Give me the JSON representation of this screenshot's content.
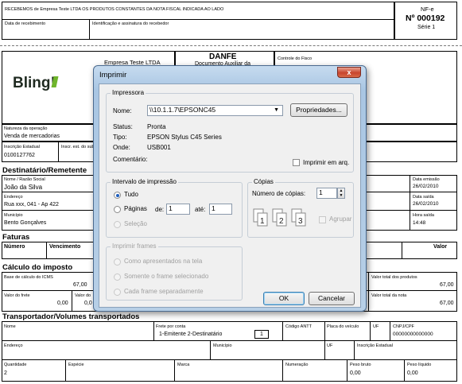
{
  "doc": {
    "recebemos": "RECEBEMOS de Empresa Teste LTDA OS PRODUTOS CONSTANTES DA NOTA FISCAL INDICADA AO LADO",
    "data_recebimento": "Data de recebimento",
    "identificacao": "Identificação e assinatura do recebedor",
    "nfe_label": "NF-e",
    "nfe_numero": "Nº 000192",
    "serie": "Série 1",
    "empresa": "Empresa Teste LTDA",
    "logo": "Bling!",
    "danfe": "DANFE",
    "danfe_sub": "Documento Auxiliar da",
    "controle_fisco": "Controle do Fisco",
    "natureza_lbl": "Natureza da operação",
    "natureza_val": "Venda de mercadorias",
    "ie_lbl": "Inscrição Estadual",
    "ie_val": "0100127762",
    "ie_sub_lbl": "Inscr. est. do subst",
    "dest_title": "Destinatário/Remetente",
    "nome_lbl": "Nome / Razão Social",
    "nome_val": "João da Silva",
    "endereco_lbl": "Endereço",
    "endereco_val": "Rua xxx, 041 - Ap 422",
    "municipio_lbl": "Município",
    "municipio_val": "Bento Gonçalves",
    "data_emissao_lbl": "Data emissão",
    "data_emissao_val": "26/02/2010",
    "data_saida_lbl": "Data saída",
    "data_saida_val": "26/02/2010",
    "hora_saida_lbl": "Hora saída",
    "hora_saida_val": "14:48",
    "faturas_title": "Faturas",
    "fat_numero": "Número",
    "fat_vencimento": "Vencimento",
    "fat_valor1": "Valor",
    "fat_valor2": "Valor",
    "calc_title": "Cálculo do imposto",
    "base_icms_lbl": "Base de cálculo do ICMS",
    "base_icms_val": "67,00",
    "valor_frete_lbl": "Valor do frete",
    "valor_frete_val": "0,00",
    "valor_do_lbl": "Valor do",
    "valor_do_val": "0,0",
    "total_produtos_lbl": "Valor total dos produtos",
    "total_produtos_val": "67,00",
    "total_nota_lbl": "Valor total da nota",
    "total_nota_val": "67,00",
    "transp_title": "Transportador/Volumes transportados",
    "t_nome_lbl": "Nome",
    "t_frete_lbl": "Frete por conta",
    "t_frete_val": "1-Emitente 2-Destinatário",
    "t_frete_box": "1",
    "t_antt_lbl": "Código ANTT",
    "t_placa_lbl": "Placa do veículo",
    "t_uf_lbl": "UF",
    "t_cnpj_lbl": "CNPJ/CPF",
    "t_cnpj_val": "00000000000000",
    "t_end_lbl": "Endereço",
    "t_mun_lbl": "Município",
    "t_uf2_lbl": "UF",
    "t_ie_lbl": "Inscrição Estadual",
    "t_qtd_lbl": "Quantidade",
    "t_qtd_val": "2",
    "t_especie_lbl": "Espécie",
    "t_marca_lbl": "Marca",
    "t_numeracao_lbl": "Numeração",
    "t_pbruto_lbl": "Peso bruto",
    "t_pbruto_val": "0,00",
    "t_pliq_lbl": "Peso líquido",
    "t_pliq_val": "0,00"
  },
  "dialog": {
    "title": "Imprimir",
    "close": "x",
    "impressora_group": "Impressora",
    "nome_lbl": "Nome:",
    "printer_name": "\\\\10.1.1.7\\EPSONC45",
    "propriedades": "Propriedades...",
    "status_lbl": "Status:",
    "status_val": "Pronta",
    "tipo_lbl": "Tipo:",
    "tipo_val": "EPSON Stylus C45 Series",
    "onde_lbl": "Onde:",
    "onde_val": "USB001",
    "comentario_lbl": "Comentário:",
    "imprimir_arq": "Imprimir em arq.",
    "intervalo_group": "Intervalo de impressão",
    "tudo": "Tudo",
    "paginas": "Páginas",
    "de_lbl": "de:",
    "de_val": "1",
    "ate_lbl": "até:",
    "ate_val": "1",
    "selecao": "Seleção",
    "copias_group": "Cópias",
    "num_copias_lbl": "Número de cópias:",
    "num_copias_val": "1",
    "agrupar": "Agrupar",
    "frames_group": "Imprimir frames",
    "frame_opt1": "Como apresentados na tela",
    "frame_opt2": "Somente o frame selecionado",
    "frame_opt3": "Cada frame separadamente",
    "ok": "OK",
    "cancelar": "Cancelar"
  }
}
